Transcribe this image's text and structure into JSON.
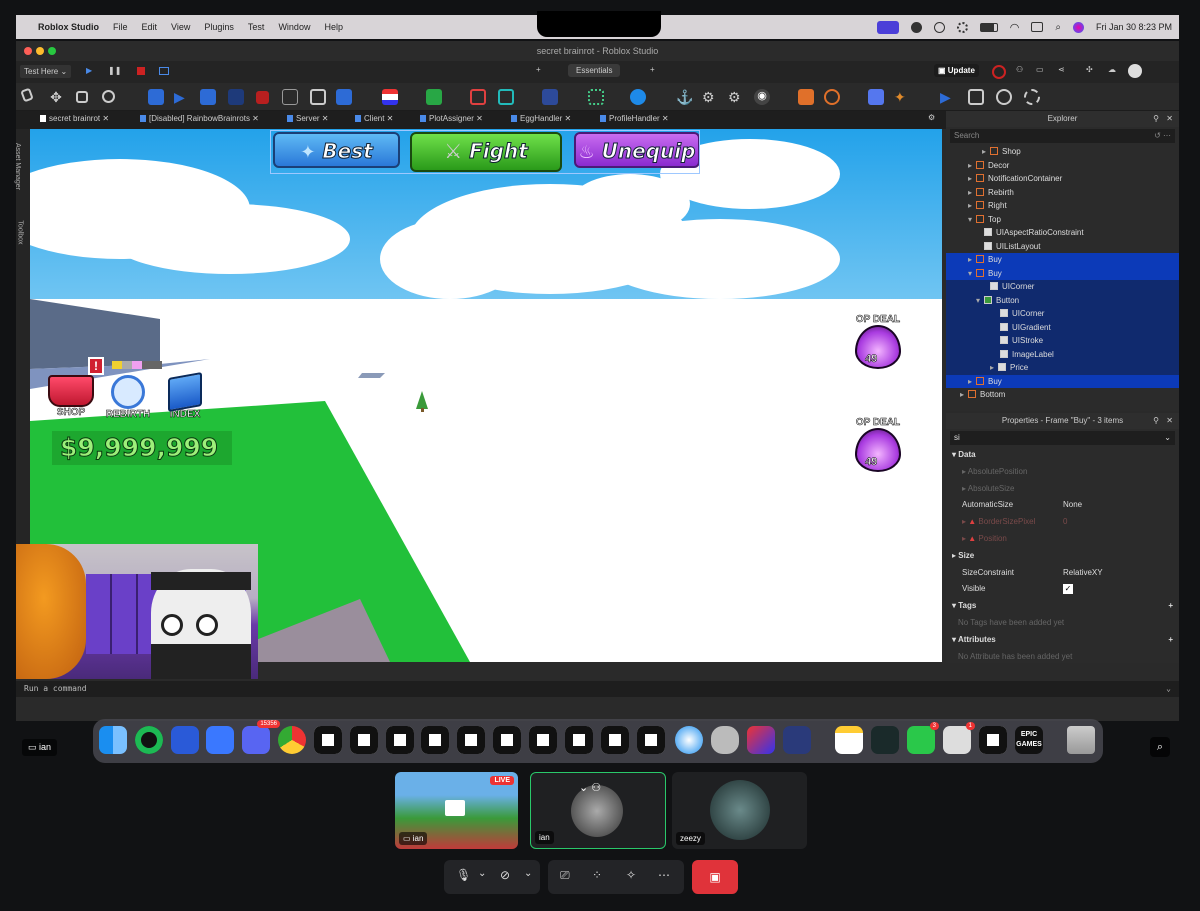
{
  "menubar": {
    "app_name": "Roblox Studio",
    "menus": [
      "File",
      "Edit",
      "View",
      "Plugins",
      "Test",
      "Window",
      "Help"
    ],
    "datetime": "Fri Jan 30  8:23 PM"
  },
  "window": {
    "title": "secret brainrot - Roblox Studio"
  },
  "quick_access": {
    "test_mode": "Test Here",
    "tab_label": "Essentials",
    "update_label": "Update"
  },
  "tabs": [
    {
      "label": "secret brainrot"
    },
    {
      "label": "[Disabled] RainbowBrainrots"
    },
    {
      "label": "Server"
    },
    {
      "label": "Client"
    },
    {
      "label": "PlotAssigner"
    },
    {
      "label": "EggHandler"
    },
    {
      "label": "ProfileHandler"
    }
  ],
  "side_labels": [
    "Asset Manager",
    "Toolbox"
  ],
  "game_ui": {
    "buttons": [
      {
        "label": "Best"
      },
      {
        "label": "Fight"
      },
      {
        "label": "Unequip"
      }
    ],
    "hud": {
      "shop": "SHOP",
      "rebirth": "REBIRTH",
      "index": "INDEX",
      "alert": "!",
      "money": "$9,999,999"
    },
    "deals": [
      {
        "label": "OP DEAL",
        "price": "49"
      },
      {
        "label": "OP DEAL",
        "price": "49"
      }
    ]
  },
  "explorer": {
    "title": "Explorer",
    "search_placeholder": "Search",
    "items": [
      {
        "label": "Shop",
        "selected": false
      },
      {
        "label": "Decor",
        "selected": false
      },
      {
        "label": "NotificationContainer",
        "selected": false
      },
      {
        "label": "Rebirth",
        "selected": false
      },
      {
        "label": "Right",
        "selected": false
      },
      {
        "label": "Top",
        "selected": false
      },
      {
        "label": "UIAspectRatioConstraint",
        "selected": false
      },
      {
        "label": "UIListLayout",
        "selected": false
      },
      {
        "label": "Buy",
        "selected": true
      },
      {
        "label": "Buy",
        "selected": true
      },
      {
        "label": "UICorner",
        "selected": true
      },
      {
        "label": "Button",
        "selected": true
      },
      {
        "label": "UICorner",
        "selected": true
      },
      {
        "label": "UIGradient",
        "selected": true
      },
      {
        "label": "UIStroke",
        "selected": true
      },
      {
        "label": "ImageLabel",
        "selected": true
      },
      {
        "label": "Price",
        "selected": true
      },
      {
        "label": "Buy",
        "selected": true
      },
      {
        "label": "Bottom",
        "selected": false
      }
    ]
  },
  "properties": {
    "title": "Properties - Frame \"Buy\" - 3 items",
    "filter": "si",
    "sections": {
      "data": "Data",
      "size": "Size",
      "tags": "Tags",
      "attributes": "Attributes"
    },
    "rows": {
      "absolute_position": "AbsolutePosition",
      "absolute_size": "AbsoluteSize",
      "automatic_size": "AutomaticSize",
      "automatic_size_value": "None",
      "border_size_pixel": "BorderSizePixel",
      "border_size_pixel_value": "0",
      "position": "Position",
      "size_constraint": "SizeConstraint",
      "size_constraint_value": "RelativeXY",
      "visible": "Visible"
    },
    "tags_empty": "No Tags have been added yet",
    "attributes_empty": "No Attribute has been added yet"
  },
  "command_bar": {
    "placeholder": "Run a command"
  },
  "dock": {
    "badges": {
      "discord": "15356",
      "messages": "3",
      "printer": "1"
    },
    "epic_label": "EPIC GAMES"
  },
  "meeting": {
    "presenter_label": "ian",
    "live_badge": "LIVE",
    "tiles": [
      {
        "name": "ian"
      },
      {
        "name": "ian"
      },
      {
        "name": "zeezy"
      }
    ]
  },
  "colors": {
    "selection": "#0c3ab8",
    "leave_button": "#e0333a",
    "baseplate": "#22c03a",
    "sky": "#2fa8e8"
  }
}
